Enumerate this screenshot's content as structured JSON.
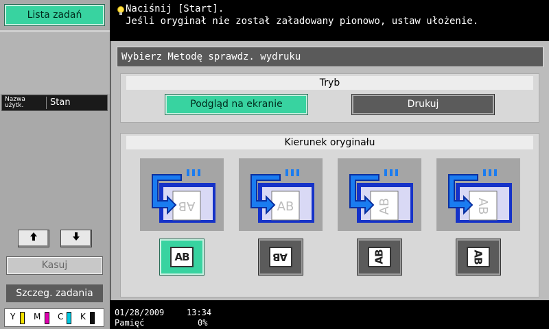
{
  "left_panel": {
    "job_list_label": "Lista zadań",
    "user_col_label": "Nazwa użytk.",
    "status_col_label": "Stan",
    "arrow_up": "🡅",
    "arrow_down": "🡇",
    "delete_label": "Kasuj",
    "job_details_label": "Szczeg. zadania",
    "toner": [
      {
        "letter": "Y",
        "color": "#f2e000"
      },
      {
        "letter": "M",
        "color": "#e000b0"
      },
      {
        "letter": "C",
        "color": "#00c8e0"
      },
      {
        "letter": "K",
        "color": "#111111"
      }
    ]
  },
  "message": {
    "line1": "Naciśnij [Start].",
    "line2": "Jeśli oryginał nie został załadowany pionowo, ustaw ułożenie."
  },
  "main": {
    "title": "Wybierz Metodę sprawdz. wydruku",
    "mode": {
      "heading": "Tryb",
      "preview_label": "Podgląd na ekranie",
      "print_label": "Drukuj",
      "selected": "preview"
    },
    "direction": {
      "heading": "Kierunek oryginału",
      "options": [
        {
          "glyph": "AB",
          "icon": "orientation-upright-icon",
          "selected": true
        },
        {
          "glyph": "AB",
          "icon": "orientation-upside-down-icon",
          "selected": false
        },
        {
          "glyph": "AB",
          "icon": "orientation-rotated-left-icon",
          "selected": false
        },
        {
          "glyph": "AB",
          "icon": "orientation-rotated-right-icon",
          "selected": false
        }
      ]
    }
  },
  "status_bar": {
    "date": "01/28/2009",
    "time": "13:34",
    "memory_label": "Pamięć",
    "memory_value": "0%"
  },
  "colors": {
    "accent_green": "#38d3a0",
    "panel_gray": "#bcbcbc",
    "blue_icon": "#1532c8"
  }
}
